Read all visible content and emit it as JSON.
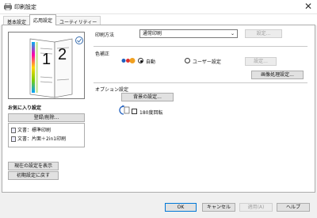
{
  "window": {
    "title": "印刷設定",
    "close_glyph": "✕"
  },
  "tabs": [
    {
      "label": "基本設定"
    },
    {
      "label": "応用設定"
    },
    {
      "label": "ユーティリティー"
    }
  ],
  "preview": {
    "page1": "1",
    "page2": "2"
  },
  "favorites": {
    "heading": "お気に入り設定",
    "register_button": "登録/削除...",
    "items": [
      {
        "label": "文書：標準印刷"
      },
      {
        "label": "文書：片面＋2in1印刷"
      }
    ]
  },
  "print_method": {
    "label": "印刷方法",
    "value": "通常印刷",
    "settings_button": "設定..."
  },
  "color_correction": {
    "label": "色補正",
    "auto_label": "自動",
    "user_label": "ユーザー設定",
    "settings_button": "設定...",
    "image_processing_button": "画像処理設定..."
  },
  "options": {
    "label": "オプション設定",
    "background_button": "背景の設定...",
    "rotate_label": "180度回転"
  },
  "left_buttons": {
    "show_current": "現在の設定を表示",
    "reset_defaults": "初期設定に戻す"
  },
  "footer": {
    "ok": "OK",
    "cancel": "キャンセル",
    "apply": "適用(A)",
    "help": "ヘルプ"
  }
}
